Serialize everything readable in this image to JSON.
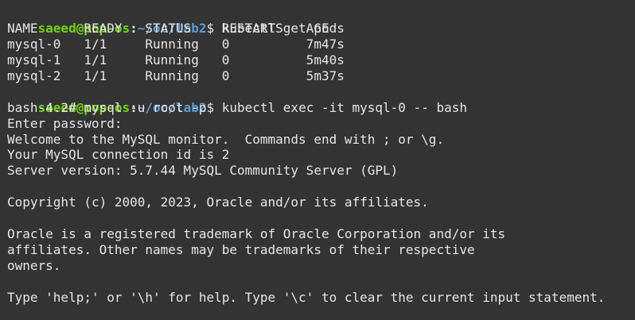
{
  "colors": {
    "background": "#333333",
    "foreground": "#e6e6e6",
    "prompt_user": "#73d216",
    "prompt_path": "#5c9bd6"
  },
  "prompt": {
    "user_host": "saeed@pop-os",
    "separator": ":",
    "path": "~/oc/lab2",
    "symbol": "$ "
  },
  "commands": [
    "kubectl get pods",
    "kubectl exec -it mysql-0 -- bash"
  ],
  "pods_table": {
    "header": "NAME      READY   STATUS    RESTARTS   AGE",
    "rows": [
      "mysql-0   1/1     Running   0          7m47s",
      "mysql-1   1/1     Running   0          5m40s",
      "mysql-2   1/1     Running   0          5m37s"
    ]
  },
  "mysql_session": {
    "bash_prompt": "bash-4.2# mysql -u root -p",
    "enter_password": "Enter password:",
    "welcome": "Welcome to the MySQL monitor.  Commands end with ; or \\g.",
    "connection_id": "Your MySQL connection id is 2",
    "server_version": "Server version: 5.7.44 MySQL Community Server (GPL)",
    "copyright": "Copyright (c) 2000, 2023, Oracle and/or its affiliates.",
    "trademark_1": "Oracle is a registered trademark of Oracle Corporation and/or its",
    "trademark_2": "affiliates. Other names may be trademarks of their respective",
    "trademark_3": "owners.",
    "help": "Type 'help;' or '\\h' for help. Type '\\c' to clear the current input statement."
  }
}
